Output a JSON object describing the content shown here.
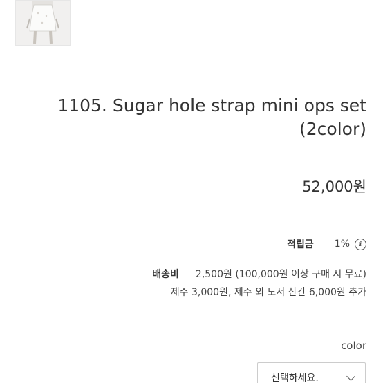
{
  "product": {
    "title": "1105. Sugar hole strap mini ops set (2color)",
    "price": "52,000원"
  },
  "points": {
    "label": "적립금",
    "value": "1%",
    "icon": "info-icon",
    "icon_glyph": "i"
  },
  "shipping": {
    "label": "배송비",
    "value": "2,500원 (100,000원 이상 구매 시 무료)",
    "extra": "제주 3,000원, 제주 외 도서 산간 6,000원 추가"
  },
  "option": {
    "label": "color",
    "select_placeholder": "선택하세요."
  }
}
